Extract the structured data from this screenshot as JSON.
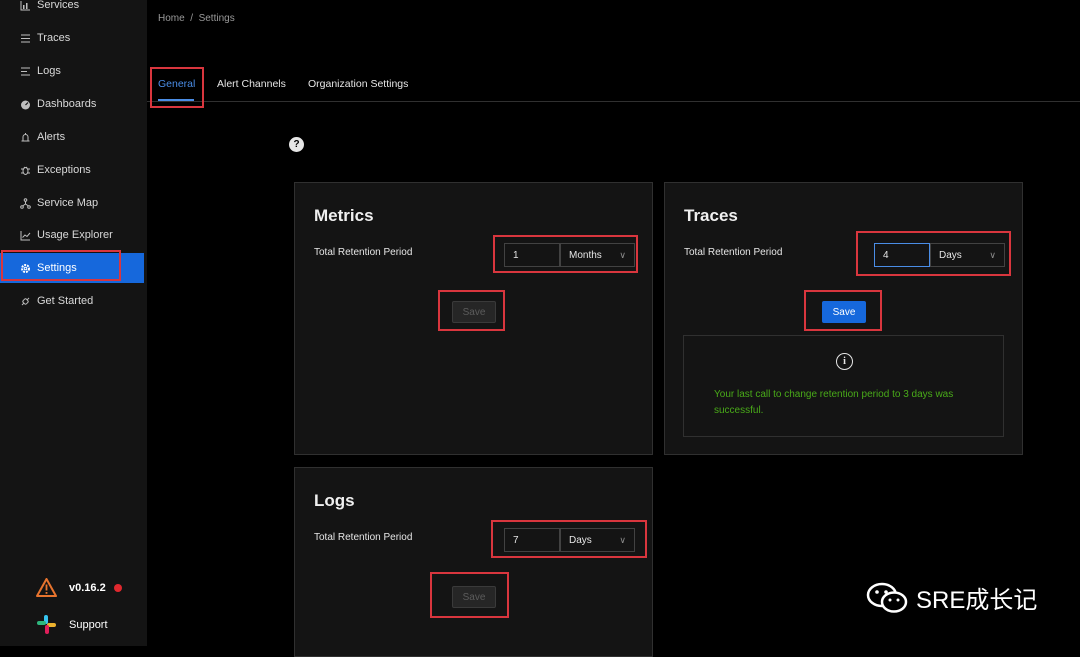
{
  "breadcrumb": "Home  /  Settings",
  "sidebar": {
    "items": [
      {
        "label": "Services",
        "icon": "bar-chart-icon"
      },
      {
        "label": "Traces",
        "icon": "menu-icon"
      },
      {
        "label": "Logs",
        "icon": "align-left-icon"
      },
      {
        "label": "Dashboards",
        "icon": "dashboard-icon"
      },
      {
        "label": "Alerts",
        "icon": "alarm-icon"
      },
      {
        "label": "Exceptions",
        "icon": "bug-icon"
      },
      {
        "label": "Service Map",
        "icon": "deployment-icon"
      },
      {
        "label": "Usage Explorer",
        "icon": "line-chart-icon"
      },
      {
        "label": "Settings",
        "icon": "gear-icon"
      },
      {
        "label": "Get Started",
        "icon": "api-icon"
      }
    ],
    "active": "Settings",
    "version": "v0.16.2",
    "support": "Support"
  },
  "tabs": [
    {
      "label": "General"
    },
    {
      "label": "Alert Channels"
    },
    {
      "label": "Organization Settings"
    }
  ],
  "metrics": {
    "title": "Metrics",
    "retention_label": "Total Retention Period",
    "value": "1",
    "unit": "Months",
    "save": "Save"
  },
  "traces": {
    "title": "Traces",
    "retention_label": "Total Retention Period",
    "value": "4",
    "unit": "Days",
    "save": "Save",
    "notice": "Your last call to change retention period to 3 days was successful."
  },
  "logs": {
    "title": "Logs",
    "retention_label": "Total Retention Period",
    "value": "7",
    "unit": "Days",
    "save": "Save"
  },
  "watermark": "SRE成长记",
  "colors": {
    "accent": "#1668dc",
    "highlight": "#d9363e",
    "success": "#49aa19"
  }
}
